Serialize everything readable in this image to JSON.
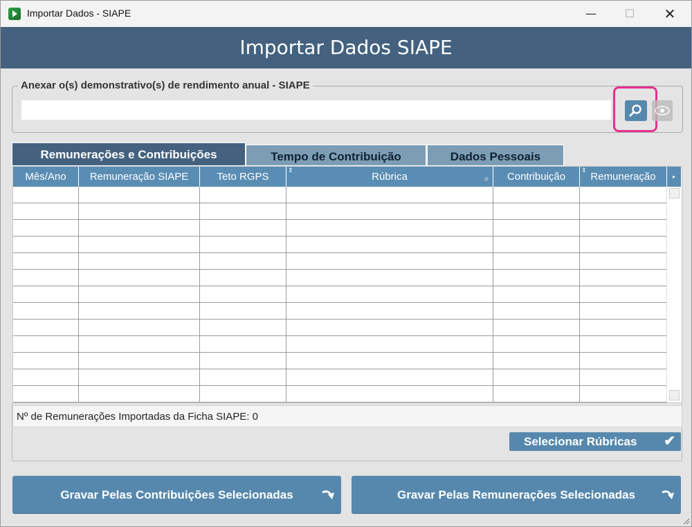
{
  "window": {
    "title": "Importar Dados - SIAPE",
    "minimize_icon": "minimize-icon",
    "maximize_icon": "maximize-icon",
    "close_icon": "close-icon",
    "minimize_glyph": "—",
    "maximize_glyph": "☐",
    "close_glyph": "✕"
  },
  "header": {
    "title": "Importar Dados SIAPE"
  },
  "attach": {
    "label": "Anexar o(s) demonstrativo(s) de rendimento anual - SIAPE",
    "value": "",
    "search_icon": "search-icon",
    "view_icon": "eye-icon"
  },
  "tabs": [
    {
      "label": "Remunerações e Contribuições",
      "active": true
    },
    {
      "label": "Tempo de Contribuição",
      "active": false
    },
    {
      "label": "Dados Pessoais",
      "active": false
    }
  ],
  "grid": {
    "columns": [
      "Mês/Ano",
      "Remuneração SIAPE",
      "Teto RGPS",
      "Rúbrica",
      "Contribuição",
      "Remuneração"
    ],
    "rows": []
  },
  "footer": {
    "count_text": "Nº de Remunerações Importadas da Ficha SIAPE: 0"
  },
  "buttons": {
    "select_rubricas": "Selecionar Rúbricas",
    "save_contributions": "Gravar Pelas Contribuições Selecionadas",
    "save_remunerations": "Gravar Pelas Remunerações Selecionadas"
  },
  "colors": {
    "header_bg": "#44627f",
    "accent": "#5688ad",
    "highlight": "#e5318f"
  }
}
